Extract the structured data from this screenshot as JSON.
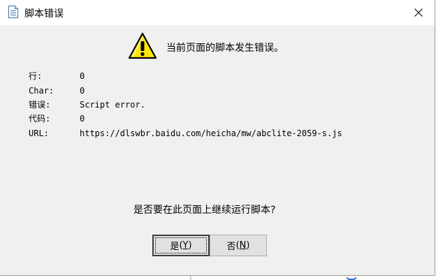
{
  "window": {
    "title": "脚本错误",
    "close_icon": "close-icon"
  },
  "message": {
    "text": "当前页面的脚本发生错误。",
    "icon": "warning-icon"
  },
  "details": [
    {
      "label": "行:",
      "value": "0"
    },
    {
      "label": "Char:",
      "value": "0"
    },
    {
      "label": "错误:",
      "value": "Script error."
    },
    {
      "label": "代码:",
      "value": "0"
    },
    {
      "label": "URL:",
      "value": "https://dlswbr.baidu.com/heicha/mw/abclite-2059-s.js"
    }
  ],
  "question": "是否要在此页面上继续运行脚本?",
  "buttons": {
    "yes": {
      "label": "是",
      "accelerator": "Y"
    },
    "no": {
      "label": "否",
      "accelerator": "N"
    }
  }
}
